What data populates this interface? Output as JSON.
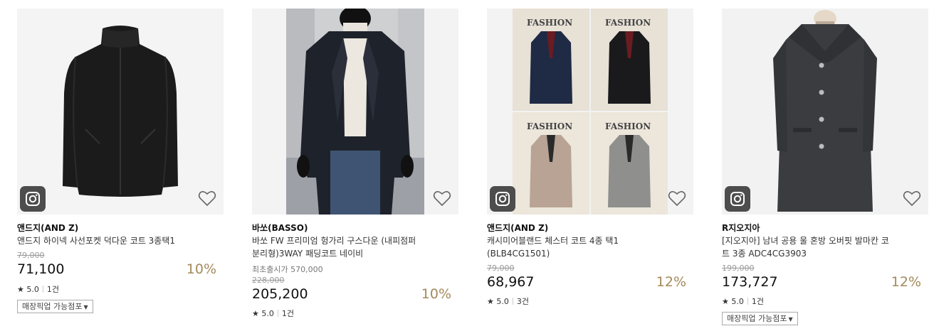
{
  "products": [
    {
      "brand": "앤드지(AND Z)",
      "name_lines": [
        "앤드지 하이넥 사선포켓 덕다운 코트 3종택1"
      ],
      "original_price": "79,000",
      "price": "71,100",
      "discount": "10%",
      "rating": "5.0",
      "review_count": "1건",
      "pickup_label": "매장픽업 가능점포",
      "icons": [
        "instagram-icon",
        "heart-outline-icon",
        "caret-down-icon"
      ]
    },
    {
      "brand": "바쏘(BASSO)",
      "name_lines": [
        "바쏘 FW 프리미엄 헝가리 구스다운 (내피점퍼",
        "분리형)3WAY 패딩코트 네이비"
      ],
      "launch_price_note": "최초출시가 570,000",
      "original_price": "228,000",
      "price": "205,200",
      "discount": "10%",
      "rating": "5.0",
      "review_count": "1건",
      "icons": [
        "heart-outline-icon"
      ]
    },
    {
      "brand": "앤드지(AND Z)",
      "name_lines": [
        "캐시미어블랜드 체스터 코트 4종 택1",
        "(BLB4CG1501)"
      ],
      "original_price": "79,000",
      "price": "68,967",
      "discount": "12%",
      "rating": "5.0",
      "review_count": "3건",
      "photo_text": [
        "FASHION",
        "FASHION",
        "FASHION",
        "FASHION"
      ],
      "icons": [
        "instagram-icon",
        "heart-outline-icon"
      ]
    },
    {
      "brand": "R지오지아",
      "name_lines": [
        "[지오지아] 남녀 공용 울 혼방 오버핏 발마칸 코",
        "트 3종 ADC4CG3903"
      ],
      "original_price": "199,000",
      "price": "173,727",
      "discount": "12%",
      "rating": "5.0",
      "review_count": "1건",
      "pickup_label": "매장픽업 가능점포",
      "icons": [
        "instagram-icon",
        "heart-outline-icon",
        "caret-down-icon"
      ]
    }
  ],
  "colors": {
    "discount": "#a3895a",
    "price": "#111111",
    "strike": "#999999",
    "thumb_bg": "#f3f3f3",
    "insta_badge": "#4d4d4d"
  }
}
